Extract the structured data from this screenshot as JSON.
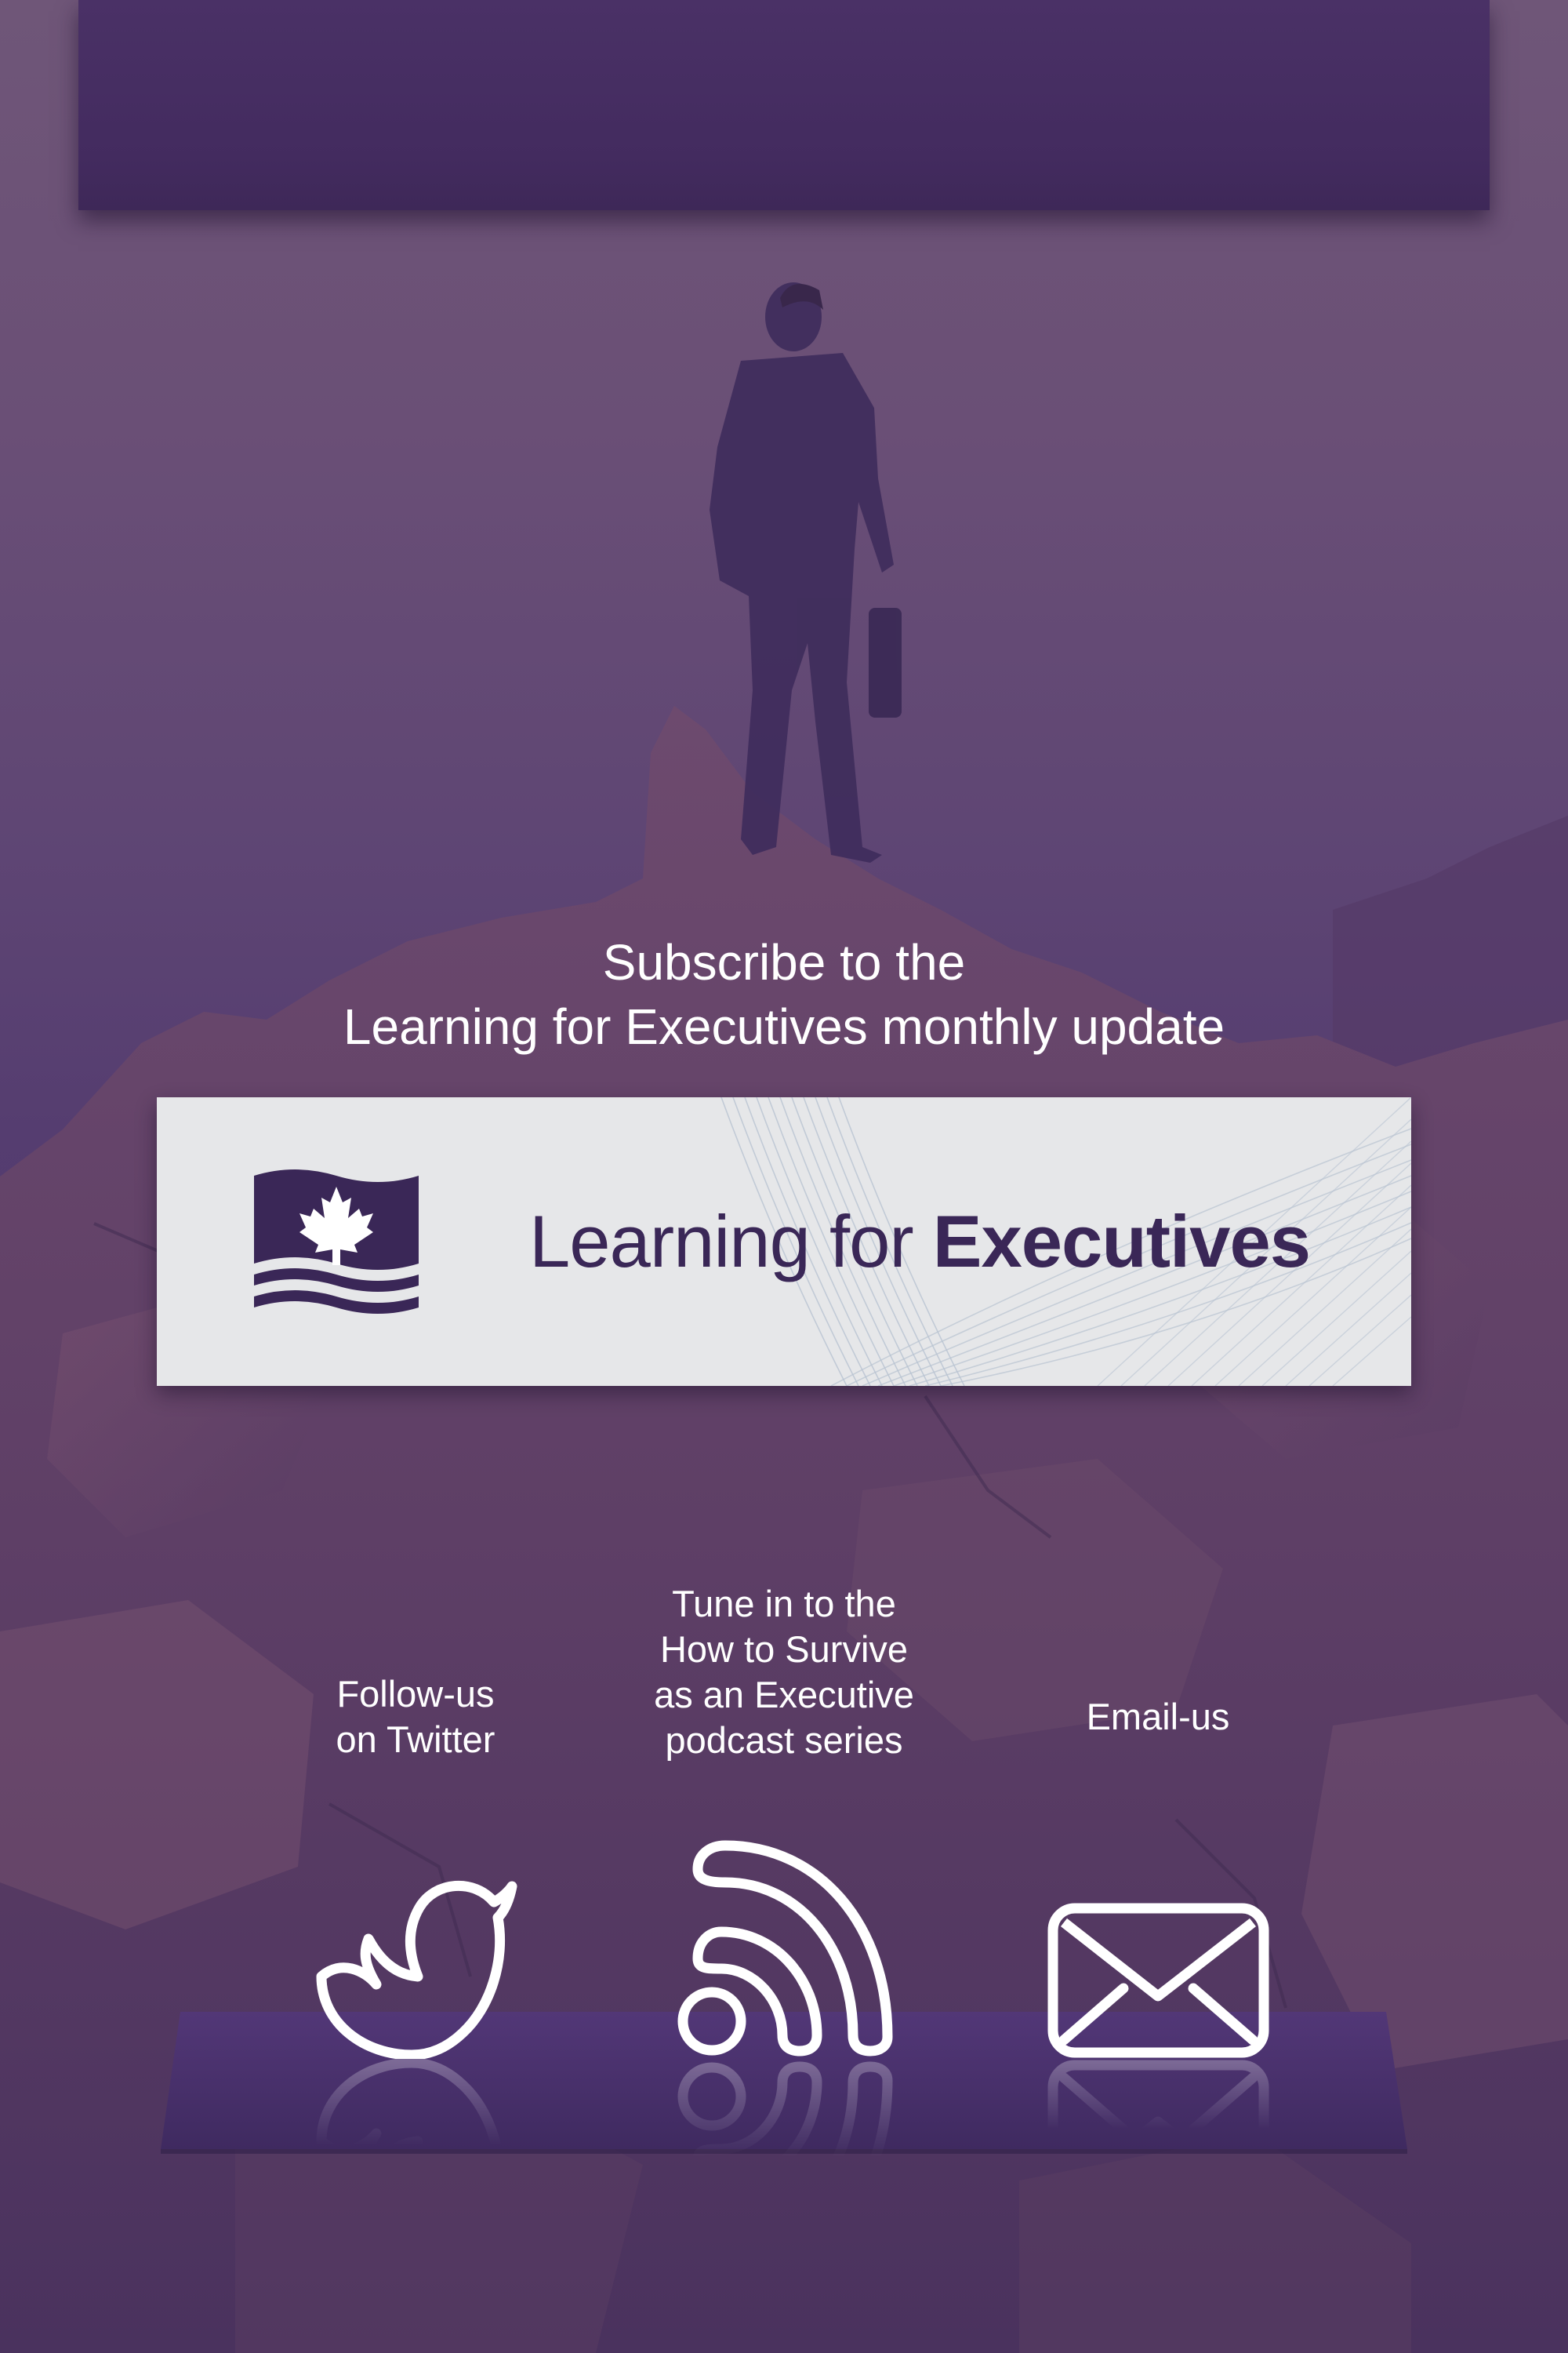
{
  "headline": {
    "line1": "Subscribe to the",
    "line2": "Learning for Executives monthly update"
  },
  "logo": {
    "regular_text": "Learning for ",
    "bold_text": "Executives",
    "icon": "canada-flag-book-icon"
  },
  "social": {
    "twitter": {
      "line1": "Follow-us",
      "line2": "on Twitter",
      "icon": "twitter-bird-icon"
    },
    "podcast": {
      "line1": "Tune in to the",
      "line2": "How to Survive",
      "line3": "as an Executive",
      "line4": "podcast series",
      "icon": "rss-podcast-icon"
    },
    "email": {
      "line1": "Email-us",
      "icon": "envelope-icon"
    }
  },
  "colors": {
    "brand_purple": "#3a2757",
    "banner_purple": "#432b5f",
    "card_gray": "#e6e7e9",
    "text_white": "#ffffff"
  }
}
